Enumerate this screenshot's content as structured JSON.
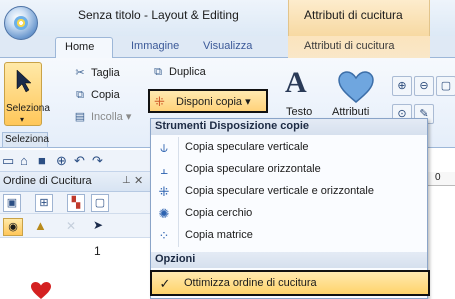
{
  "window": {
    "title": "Senza titolo - Layout & Editing",
    "context_header": "Attributi di cucitura"
  },
  "tabs": {
    "home": "Home",
    "immagine": "Immagine",
    "visualizza": "Visualizza",
    "attributi": "Attributi di cucitura"
  },
  "ribbon": {
    "seleziona": "Seleziona",
    "seleziona_group": "Seleziona",
    "taglia": "Taglia",
    "copia": "Copia",
    "incolla": "Incolla",
    "duplica": "Duplica",
    "disponi_copia": "Disponi copia",
    "testo": "Testo",
    "attributi": "Attributi"
  },
  "panel": {
    "title": "Ordine di Cucitura",
    "thumb_number": "1"
  },
  "ruler": {
    "zero": "0"
  },
  "menu": {
    "section_strumenti": "Strumenti Disposizione copie",
    "items": [
      {
        "label": "Copia speculare verticale",
        "icon": "mirror-vertical-icon"
      },
      {
        "label": "Copia speculare orizzontale",
        "icon": "mirror-horizontal-icon"
      },
      {
        "label": "Copia speculare verticale e orizzontale",
        "icon": "mirror-both-icon"
      },
      {
        "label": "Copia cerchio",
        "icon": "circle-copy-icon"
      },
      {
        "label": "Copia matrice",
        "icon": "matrix-copy-icon"
      }
    ],
    "section_opzioni": "Opzioni",
    "ottimizza": "Ottimizza ordine di cucitura",
    "ottimizza_checked": true
  },
  "colors": {
    "highlight": "#ffd27a",
    "thumb_heart": "#d42020"
  }
}
